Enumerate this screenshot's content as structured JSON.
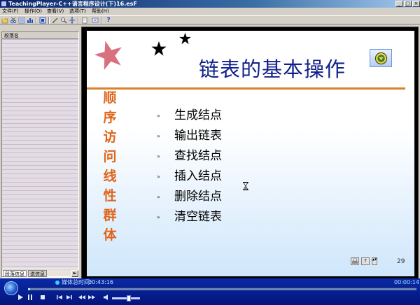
{
  "window": {
    "title": "TeachingPlayer-C++语言程序设计(下)16.esF",
    "btn_min": "_",
    "btn_max": "□",
    "btn_close": "×"
  },
  "menu": [
    {
      "label": "文件(F)"
    },
    {
      "label": "操作(O)"
    },
    {
      "label": "查看(V)"
    },
    {
      "label": "选项(T)"
    },
    {
      "label": "帮助(H)"
    }
  ],
  "toolbar": {
    "icons": [
      "open-icon",
      "cut-icon",
      "list-icon",
      "bars-icon",
      "capture-icon",
      "pen-icon",
      "search-icon",
      "move-icon",
      "doc-icon",
      "export-icon",
      "help-icon"
    ],
    "help_glyph": "?"
  },
  "left_panel": {
    "header": "段落名",
    "scroll_left": "◄",
    "scroll_right": "►",
    "tabs": [
      {
        "label": "段落信息",
        "active": true
      },
      {
        "label": "说信息",
        "active": false
      }
    ]
  },
  "slide": {
    "title": "链表的基本操作",
    "vertical_text": [
      "顺",
      "序",
      "访",
      "问",
      "线",
      "性",
      "群",
      "体"
    ],
    "bullet_mark": "»",
    "bullets": [
      "生成结点",
      "输出链表",
      "查找结点",
      "插入结点",
      "删除结点",
      "清空链表"
    ],
    "page_number": "29",
    "nav_icons": [
      "printer-icon",
      "help-box-icon",
      "spin-icon"
    ],
    "nav_help_glyph": "?",
    "nav_spin_glyph": "▲▼",
    "colors": {
      "title": "#10208a",
      "vertical_text": "#e0651a",
      "rule": "#d9822b",
      "star_large": "#d9707e",
      "star_small": "#000000"
    }
  },
  "player": {
    "label": "媒体总时间:",
    "total_time": "00:43:16",
    "current_time": "00:00:14",
    "progress_fraction": 0.005,
    "controls": [
      "play-icon",
      "pause-icon",
      "stop-icon",
      "prev-icon",
      "next-icon",
      "rewind-icon",
      "forward-icon",
      "speaker-icon"
    ],
    "volume_fraction": 0.6
  }
}
